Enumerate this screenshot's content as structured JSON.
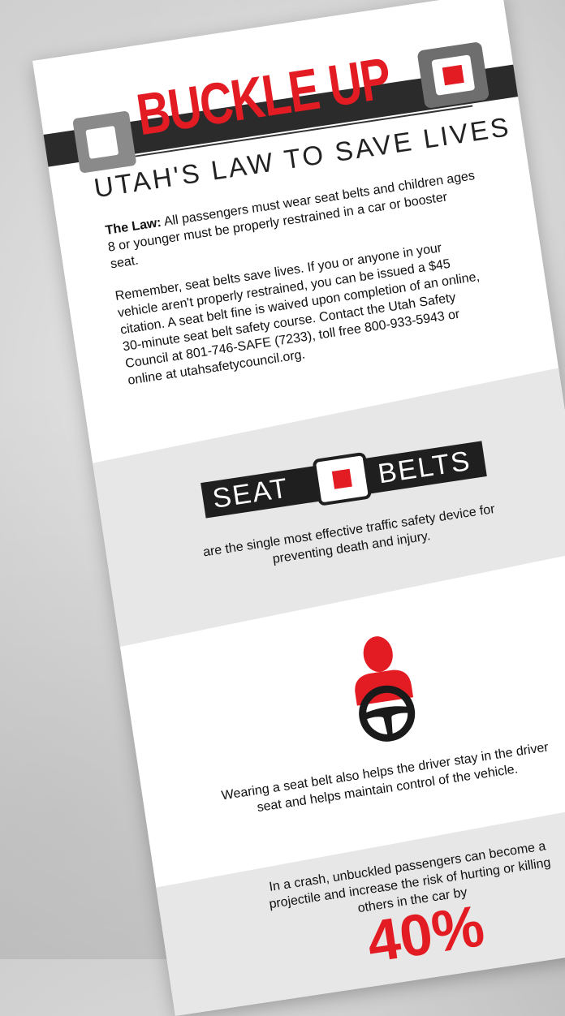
{
  "header": {
    "title": "BUCKLE UP",
    "subtitle": "UTAH'S LAW TO SAVE LIVES"
  },
  "law": {
    "label": "The Law:",
    "text": " All passengers must wear seat belts and children ages 8 or younger must be properly restrained in a car or booster seat."
  },
  "remember": {
    "text": "Remember, seat belts save lives. If you or anyone in your vehicle aren't properly restrained, you can be issued a $45 citation. A seat belt fine is waived upon completion of an online, 30-minute seat belt safety course. Contact the Utah Safety Council at 801-746-SAFE (7233), toll free 800-933-5943 or online at utahsafetycouncil.org."
  },
  "seatbelts": {
    "word_left": "SEAT",
    "word_right": "BELTS",
    "text": "are the single most effective traffic safety device for preventing death and injury."
  },
  "driver": {
    "text": "Wearing a seat belt also helps the driver stay in the driver seat and helps maintain control of the vehicle."
  },
  "crash": {
    "text": "In a crash, unbuckled passengers can become a projectile and increase the risk of hurting or killing others in the car by",
    "percent": "40%"
  },
  "colors": {
    "accent": "#e31b23",
    "dark": "#1f1f1f",
    "band": "#e7e7e7"
  },
  "icons": [
    "buckle-icon",
    "driver-icon",
    "steering-wheel-icon"
  ]
}
